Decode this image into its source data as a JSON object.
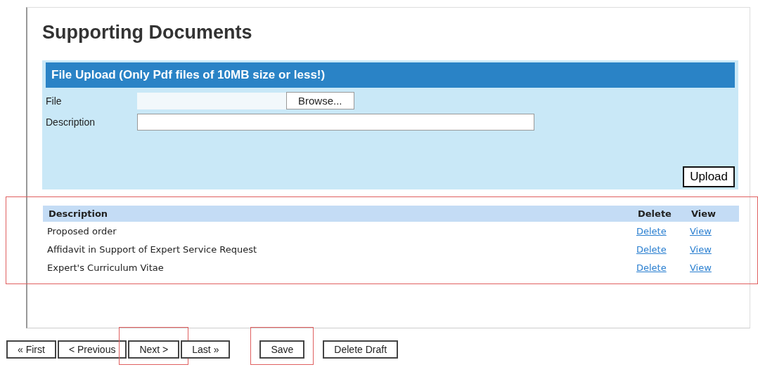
{
  "title": "Supporting Documents",
  "upload": {
    "header": "File Upload (Only Pdf files of 10MB size or less!)",
    "file_label": "File",
    "browse_button": "Browse...",
    "description_label": "Description",
    "upload_button": "Upload"
  },
  "documents": {
    "highlighted": true,
    "columns": [
      "Description",
      "Delete",
      "View"
    ],
    "rows": [
      {
        "description": "Proposed order",
        "delete": "Delete",
        "view": "View"
      },
      {
        "description": "Affidavit in Support of Expert Service Request",
        "delete": "Delete",
        "view": "View"
      },
      {
        "description": "Expert's Curriculum Vitae",
        "delete": "Delete",
        "view": "View"
      }
    ]
  },
  "nav_buttons": [
    {
      "label": "« First",
      "highlighted": false
    },
    {
      "label": "< Previous",
      "highlighted": false
    },
    {
      "label": "Next >",
      "highlighted": true
    },
    {
      "label": "Last »",
      "highlighted": false
    },
    {
      "label": "Save",
      "highlighted": true
    },
    {
      "label": "Delete Draft",
      "highlighted": false
    }
  ]
}
